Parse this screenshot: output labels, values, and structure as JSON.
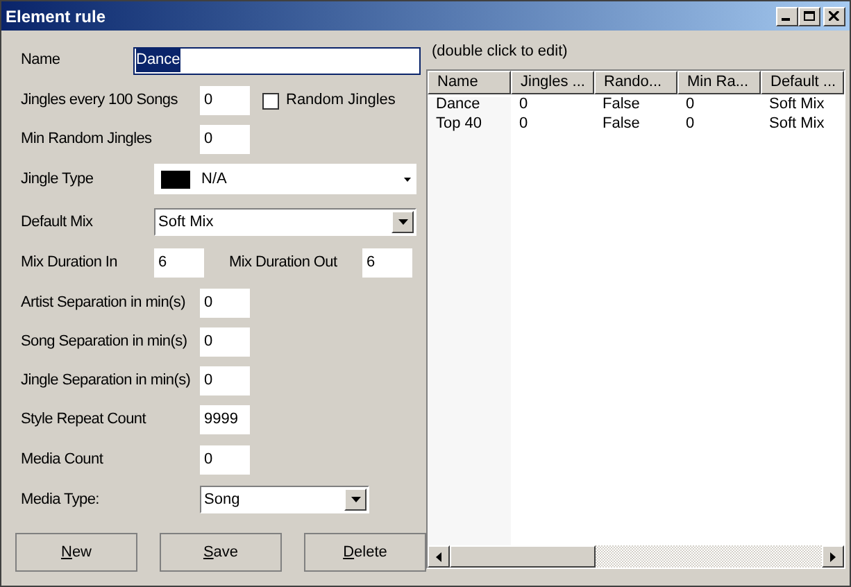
{
  "window": {
    "title": "Element rule"
  },
  "rows": [
    {
      "items": [
        {
          "kind": "name",
          "label": "Name",
          "value": "Dance",
          "text_selected": true
        }
      ]
    },
    {
      "items": [
        {
          "kind": "number",
          "label": "Jingles every 100 Songs",
          "value": "0"
        },
        {
          "kind": "checkbox",
          "label": "Random Jingles",
          "checked": false
        }
      ]
    },
    {
      "items": [
        {
          "kind": "number",
          "label": "Min Random Jingles",
          "value": "0"
        }
      ]
    },
    {
      "items": [
        {
          "kind": "color-combo",
          "label": "Jingle Type",
          "value": "N/A",
          "color": "#000000"
        }
      ]
    },
    {
      "items": [
        {
          "kind": "combo",
          "label": "Default Mix",
          "value": "Soft Mix"
        }
      ]
    },
    {
      "items": [
        {
          "kind": "number",
          "label": "Mix Duration In",
          "value": "6"
        },
        {
          "kind": "number",
          "label": "Mix Duration Out",
          "value": "6"
        }
      ]
    },
    {
      "items": [
        {
          "kind": "number",
          "label": "Artist Separation in min(s)",
          "value": "0"
        }
      ]
    },
    {
      "items": [
        {
          "kind": "number",
          "label": "Song Separation in min(s)",
          "value": "0"
        }
      ]
    },
    {
      "items": [
        {
          "kind": "number",
          "label": "Jingle Separation in min(s)",
          "value": "0"
        }
      ]
    },
    {
      "items": [
        {
          "kind": "number",
          "label": "Style Repeat Count",
          "value": "9999"
        }
      ]
    },
    {
      "items": [
        {
          "kind": "number",
          "label": "Media Count",
          "value": "0"
        }
      ]
    },
    {
      "items": [
        {
          "kind": "combo",
          "label": "Media Type:",
          "value": "Song"
        }
      ]
    }
  ],
  "buttons": [
    {
      "mnemonic": "N",
      "rest": "ew"
    },
    {
      "mnemonic": "S",
      "rest": "ave"
    },
    {
      "mnemonic": "D",
      "rest": "elete"
    }
  ],
  "list": {
    "hint": "(double click to edit)",
    "columns": [
      "Name",
      "Jingles ...",
      "Rando...",
      "Min Ra...",
      "Default ..."
    ],
    "rows": [
      [
        "Dance",
        "0",
        "False",
        "0",
        "Soft Mix"
      ],
      [
        "Top 40",
        "0",
        "False",
        "0",
        "Soft Mix"
      ]
    ]
  }
}
